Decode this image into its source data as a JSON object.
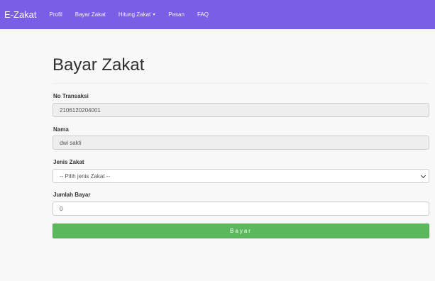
{
  "navbar": {
    "brand": "E-Zakat",
    "links": [
      {
        "label": "Profil"
      },
      {
        "label": "Bayar Zakat"
      },
      {
        "label": "Hitung Zakat",
        "dropdown": true
      },
      {
        "label": "Pesan"
      },
      {
        "label": "FAQ"
      }
    ]
  },
  "form": {
    "title": "Bayar Zakat",
    "fields": {
      "no_transaksi": {
        "label": "No Transaksi",
        "value": "2106120204001"
      },
      "nama": {
        "label": "Nama",
        "value": "dwi sakti"
      },
      "jenis_zakat": {
        "label": "Jenis Zakat",
        "selected": "-- Pilih jenis Zakat --"
      },
      "jumlah_bayar": {
        "label": "Jumlah Bayar",
        "value": "0"
      }
    },
    "submit_label": "Bayar"
  },
  "colors": {
    "navbar_bg": "#7b5ee6",
    "button_bg": "#5cb85c",
    "page_bg": "#f8f8f8"
  }
}
